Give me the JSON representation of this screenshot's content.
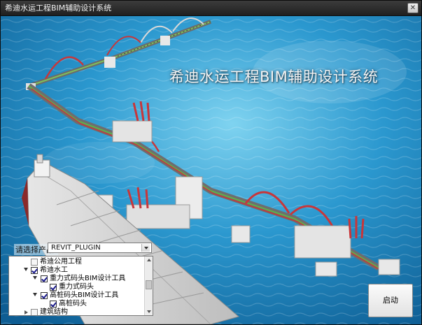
{
  "window": {
    "title": "希迪水运工程BIM辅助设计系统",
    "close_label": "✕"
  },
  "banner": {
    "title": "希迪水运工程BIM辅助设计系统"
  },
  "product": {
    "label": "请选择产品:",
    "selected": "REVIT_PLUGIN"
  },
  "tree": {
    "items": [
      {
        "label": "希迪公用工程",
        "checked": false,
        "expanded": null
      },
      {
        "label": "希迪水工",
        "checked": true,
        "expanded": true
      },
      {
        "label": "重力式码头BIM设计工具",
        "checked": true,
        "expanded": true
      },
      {
        "label": "重力式码头",
        "checked": true,
        "expanded": null
      },
      {
        "label": "高桩码头BIM设计工具",
        "checked": true,
        "expanded": true
      },
      {
        "label": "高桩码头",
        "checked": true,
        "expanded": null
      },
      {
        "label": "建筑结构",
        "checked": false,
        "expanded": false
      }
    ]
  },
  "actions": {
    "start_label": "启动"
  },
  "colors": {
    "sea": "#2a8ec8",
    "titlebar": "#2a2a2a",
    "bridge_arch": "#c8363a"
  }
}
